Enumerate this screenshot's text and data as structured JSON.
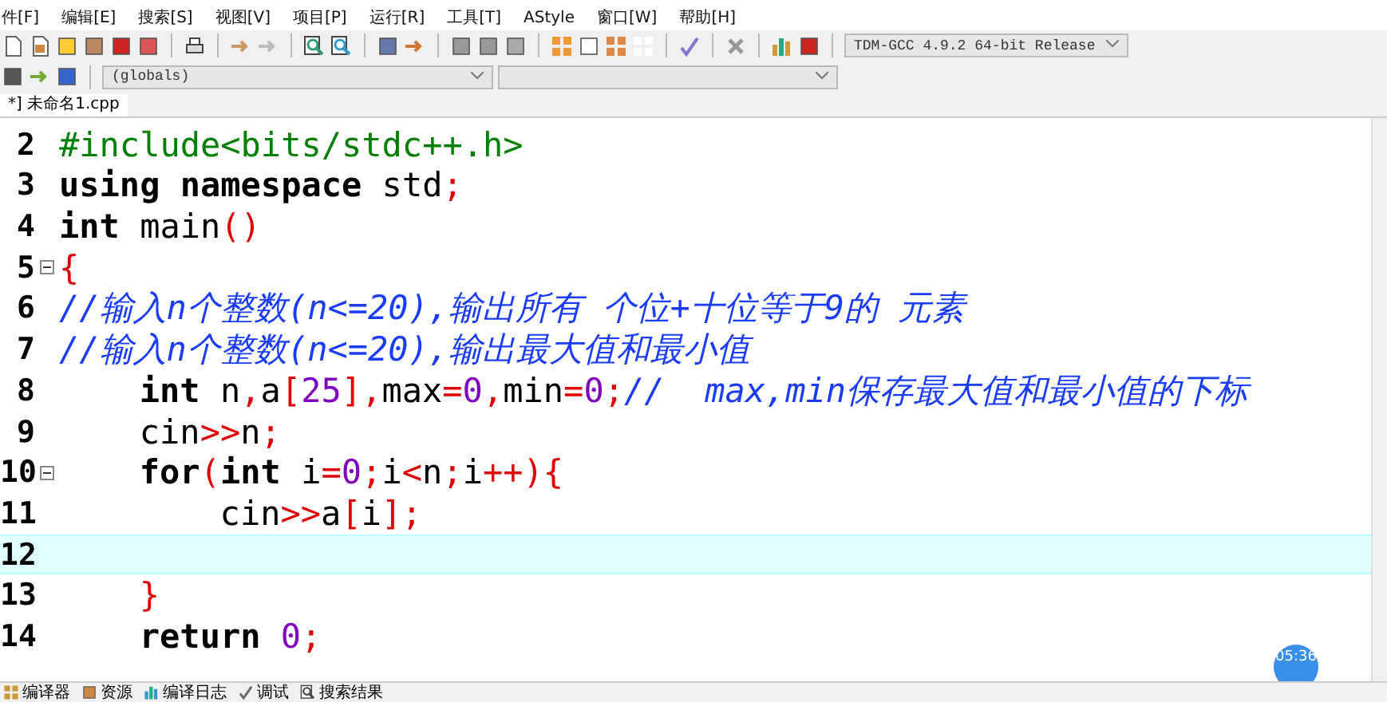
{
  "menu": [
    "件[F]",
    "编辑[E]",
    "搜索[S]",
    "视图[V]",
    "项目[P]",
    "运行[R]",
    "工具[T]",
    "AStyle",
    "窗口[W]",
    "帮助[H]"
  ],
  "compiler_select": {
    "value": "TDM-GCC 4.9.2 64-bit Release"
  },
  "scope_select": {
    "value": "(globals)"
  },
  "tabs": [
    {
      "label": "*] 未命名1.cpp",
      "selected": true
    }
  ],
  "editor": {
    "lines": [
      {
        "number": "2",
        "fold": false,
        "current": false,
        "indented": false,
        "tokens": [
          {
            "kind": "pre",
            "text": "#include<bits/stdc++.h>"
          }
        ]
      },
      {
        "number": "3",
        "fold": false,
        "current": false,
        "indented": false,
        "tokens": [
          {
            "kind": "kw",
            "text": "using "
          },
          {
            "kind": "kw",
            "text": "namespace"
          },
          {
            "kind": "plain",
            "text": " std"
          },
          {
            "kind": "sym",
            "text": ";"
          }
        ]
      },
      {
        "number": "4",
        "fold": false,
        "current": false,
        "indented": false,
        "tokens": [
          {
            "kind": "kw",
            "text": "int"
          },
          {
            "kind": "plain",
            "text": " main"
          },
          {
            "kind": "sym",
            "text": "()"
          }
        ]
      },
      {
        "number": "5",
        "fold": true,
        "current": false,
        "indented": false,
        "tokens": [
          {
            "kind": "sym",
            "text": "{"
          }
        ]
      },
      {
        "number": "6",
        "fold": false,
        "current": false,
        "indented": false,
        "tokens": [
          {
            "kind": "comment",
            "text": "//输入n个整数(n<=20),输出所有 个位+十位等于9的 元素"
          }
        ]
      },
      {
        "number": "7",
        "fold": false,
        "current": false,
        "indented": false,
        "tokens": [
          {
            "kind": "comment",
            "text": "//输入n个整数(n<=20),输出最大值和最小值"
          }
        ]
      },
      {
        "number": "8",
        "fold": false,
        "current": false,
        "indented": true,
        "tokens": [
          {
            "kind": "kw",
            "text": "int"
          },
          {
            "kind": "plain",
            "text": " n"
          },
          {
            "kind": "sym",
            "text": ","
          },
          {
            "kind": "plain",
            "text": "a"
          },
          {
            "kind": "sym",
            "text": "["
          },
          {
            "kind": "num",
            "text": "25"
          },
          {
            "kind": "sym",
            "text": "],"
          },
          {
            "kind": "plain",
            "text": "max"
          },
          {
            "kind": "sym",
            "text": "="
          },
          {
            "kind": "num",
            "text": "0"
          },
          {
            "kind": "sym",
            "text": ","
          },
          {
            "kind": "plain",
            "text": "min"
          },
          {
            "kind": "sym",
            "text": "="
          },
          {
            "kind": "num",
            "text": "0"
          },
          {
            "kind": "sym",
            "text": ";"
          },
          {
            "kind": "comment",
            "text": "//  max,min保存最大值和最小值的下标"
          }
        ]
      },
      {
        "number": "9",
        "fold": false,
        "current": false,
        "indented": true,
        "tokens": [
          {
            "kind": "plain",
            "text": "cin"
          },
          {
            "kind": "sym",
            "text": ">>"
          },
          {
            "kind": "plain",
            "text": "n"
          },
          {
            "kind": "sym",
            "text": ";"
          }
        ]
      },
      {
        "number": "10",
        "fold": true,
        "current": false,
        "indented": true,
        "tokens": [
          {
            "kind": "kw",
            "text": "for"
          },
          {
            "kind": "sym",
            "text": "("
          },
          {
            "kind": "kw",
            "text": "int"
          },
          {
            "kind": "plain",
            "text": " i"
          },
          {
            "kind": "sym",
            "text": "="
          },
          {
            "kind": "num",
            "text": "0"
          },
          {
            "kind": "sym",
            "text": ";"
          },
          {
            "kind": "plain",
            "text": "i"
          },
          {
            "kind": "sym",
            "text": "<"
          },
          {
            "kind": "plain",
            "text": "n"
          },
          {
            "kind": "sym",
            "text": ";"
          },
          {
            "kind": "plain",
            "text": "i"
          },
          {
            "kind": "sym",
            "text": "++){"
          }
        ],
        "children": [
          {
            "number": "11",
            "fold": false,
            "current": false,
            "tokens": [
              {
                "kind": "plain",
                "text": "cin"
              },
              {
                "kind": "sym",
                "text": ">>"
              },
              {
                "kind": "plain",
                "text": "a"
              },
              {
                "kind": "sym",
                "text": "["
              },
              {
                "kind": "plain",
                "text": "i"
              },
              {
                "kind": "sym",
                "text": "];"
              }
            ]
          },
          {
            "number": "12",
            "fold": false,
            "current": true
          }
        ]
      },
      {
        "number": "13",
        "fold": false,
        "current": false,
        "indented": true,
        "tokens": [
          {
            "kind": "sym",
            "text": "}"
          }
        ]
      },
      {
        "number": "14",
        "fold": false,
        "current": false,
        "indented": true,
        "tokens": [
          {
            "kind": "kw",
            "text": "return "
          },
          {
            "kind": "num",
            "text": "0"
          },
          {
            "kind": "sym",
            "text": ";"
          }
        ]
      }
    ]
  },
  "bottom_tabs": [
    "编译器",
    "资源",
    "编译日志",
    "调试",
    "搜索结果"
  ],
  "timestamp": "05:36"
}
